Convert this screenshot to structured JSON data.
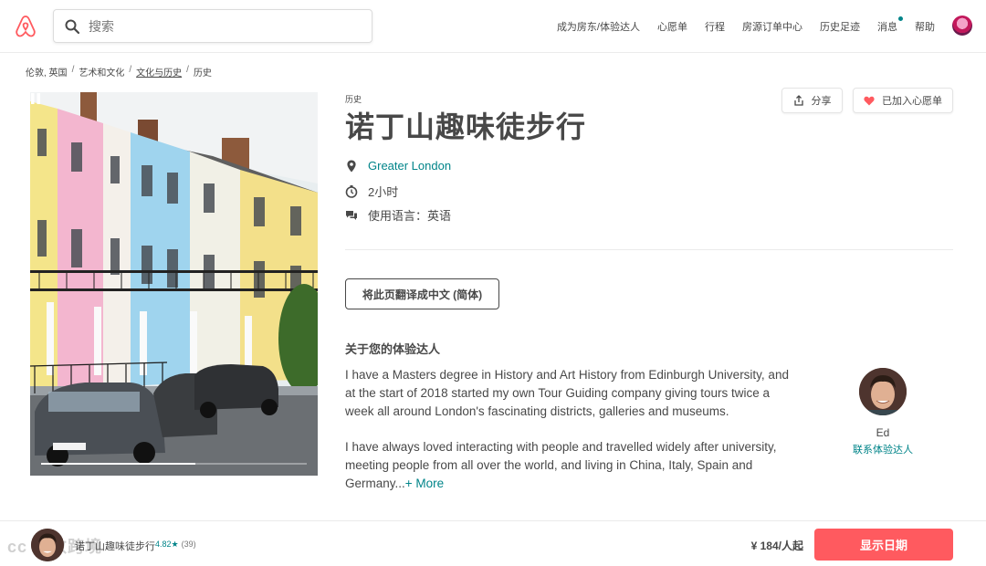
{
  "header": {
    "search_placeholder": "搜索",
    "nav": [
      {
        "label": "成为房东/体验达人",
        "dot": false
      },
      {
        "label": "心愿单",
        "dot": false
      },
      {
        "label": "行程",
        "dot": false
      },
      {
        "label": "房源订单中心",
        "dot": false
      },
      {
        "label": "历史足迹",
        "dot": false
      },
      {
        "label": "消息",
        "dot": true
      },
      {
        "label": "帮助",
        "dot": false
      }
    ]
  },
  "breadcrumb": [
    "伦敦, 英国",
    "艺术和文化",
    "文化与历史",
    "历史"
  ],
  "experience": {
    "category": "历史",
    "title": "诺丁山趣味徒步行",
    "share_label": "分享",
    "wishlist_label": "已加入心愿单",
    "location": "Greater London",
    "duration": "2小时",
    "language": "使用语言：英语",
    "translate_label": "将此页翻译成中文 (简体)",
    "video_progress": 0.58
  },
  "host": {
    "heading": "关于您的体验达人",
    "bio_1": "I have a Masters degree in History and Art History from Edinburgh University, and at the start of 2018 started my own Tour Guiding company giving tours twice a week all around London's fascinating districts, galleries and museums.",
    "bio_2": "I have always loved interacting with people and travelled widely after university, meeting people from all over the world, and living in China, Italy, Spain and Germany...",
    "more_label": "+ More",
    "name": "Ed",
    "contact_label": "联系体验达人"
  },
  "bottom_bar": {
    "title": "诺丁山趣味徒步行",
    "rating": "4.82★",
    "review_count": "(39)",
    "price": "¥ 184/人起",
    "cta_label": "显示日期",
    "watermark": "cc 大数跨境"
  },
  "colors": {
    "brand": "#FF5A5F",
    "accent": "#008489",
    "text": "#484848"
  }
}
